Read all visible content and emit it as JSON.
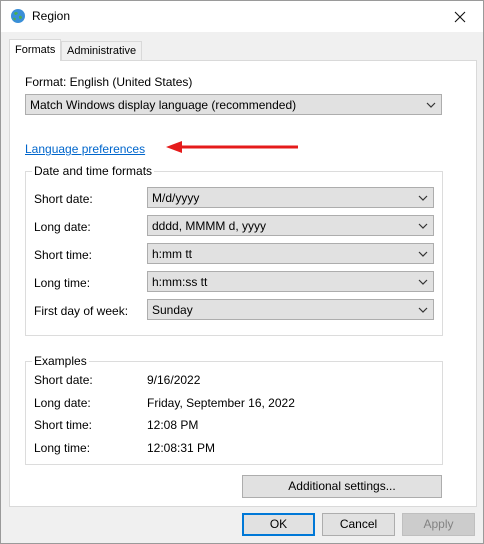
{
  "window": {
    "title": "Region",
    "close_glyph": "✕"
  },
  "tabs": [
    {
      "label": "Formats",
      "active": true
    },
    {
      "label": "Administrative",
      "active": false
    }
  ],
  "format": {
    "label": "Format: English (United States)",
    "selected": "Match Windows display language (recommended)"
  },
  "language_link": "Language preferences",
  "date_time": {
    "group_title": "Date and time formats",
    "rows": [
      {
        "label": "Short date:",
        "value": "M/d/yyyy"
      },
      {
        "label": "Long date:",
        "value": "dddd, MMMM d, yyyy"
      },
      {
        "label": "Short time:",
        "value": "h:mm tt"
      },
      {
        "label": "Long time:",
        "value": "h:mm:ss tt"
      },
      {
        "label": "First day of week:",
        "value": "Sunday"
      }
    ]
  },
  "examples": {
    "group_title": "Examples",
    "rows": [
      {
        "label": "Short date:",
        "value": "9/16/2022"
      },
      {
        "label": "Long date:",
        "value": "Friday, September 16, 2022"
      },
      {
        "label": "Short time:",
        "value": "12:08 PM"
      },
      {
        "label": "Long time:",
        "value": "12:08:31 PM"
      }
    ]
  },
  "buttons": {
    "additional": "Additional settings...",
    "ok": "OK",
    "cancel": "Cancel",
    "apply": "Apply"
  },
  "colors": {
    "accent": "#0078d7",
    "link": "#0066cc",
    "annotation_arrow": "#e51b1b"
  },
  "icons": {
    "app": "globe-icon",
    "dropdown": "chevron-down-icon",
    "close": "close-icon"
  }
}
